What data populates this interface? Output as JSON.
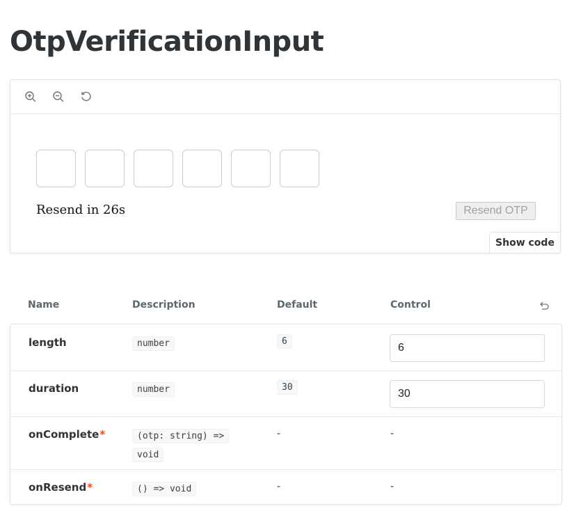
{
  "page": {
    "title": "OtpVerificationInput"
  },
  "toolbar": {
    "icons": [
      "zoom-in-icon",
      "zoom-out-icon",
      "reset-zoom-icon"
    ]
  },
  "preview": {
    "otp_length": 6,
    "otp_values": [
      "",
      "",
      "",
      "",
      "",
      ""
    ],
    "resend_text": "Resend in 26s",
    "resend_button": "Resend OTP",
    "show_code": "Show code"
  },
  "args": {
    "headers": {
      "name": "Name",
      "description": "Description",
      "default": "Default",
      "control": "Control"
    },
    "rows": [
      {
        "name": "length",
        "required": false,
        "type": "number",
        "default": "6",
        "control": "6"
      },
      {
        "name": "duration",
        "required": false,
        "type": "number",
        "default": "30",
        "control": "30"
      },
      {
        "name": "onComplete",
        "required": true,
        "type_line1": "(otp: string) =>",
        "type_line2": "void",
        "default": "-",
        "control": "-"
      },
      {
        "name": "onResend",
        "required": true,
        "type": "() => void",
        "default": "-",
        "control": "-"
      }
    ],
    "required_mark": "*"
  },
  "colors": {
    "required": "#ff4400",
    "disabled_text": "#a0a0a0"
  }
}
